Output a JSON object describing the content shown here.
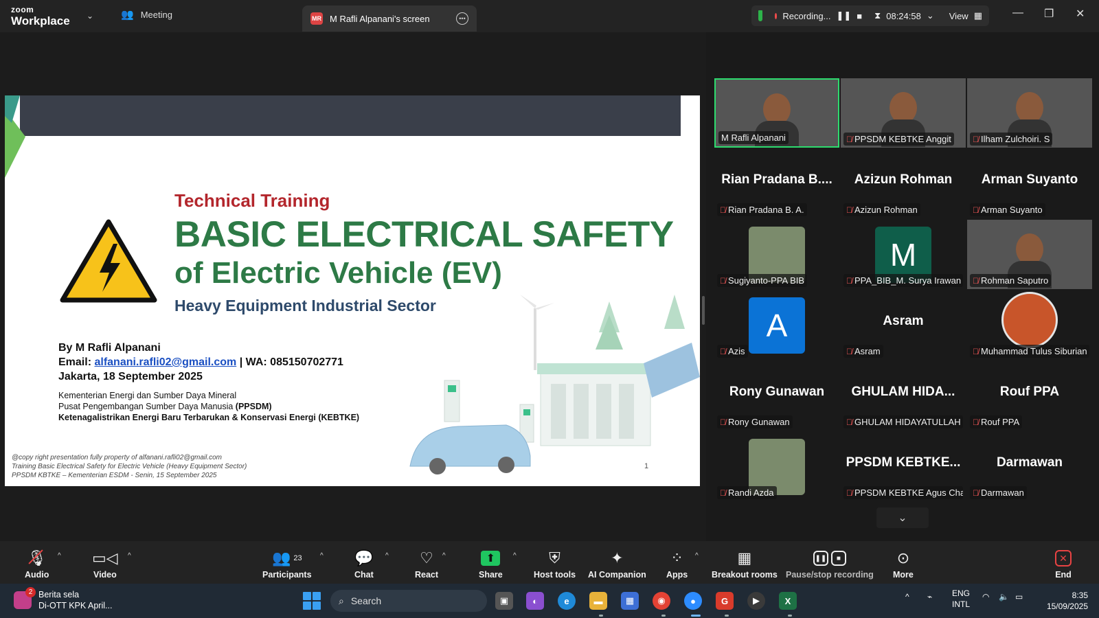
{
  "app": {
    "brand_top": "zoom",
    "brand_bottom": "Workplace"
  },
  "tabs": {
    "meeting": "Meeting",
    "screen": "M Rafli Alpanani's screen",
    "screen_badge": "MR"
  },
  "status": {
    "recording": "Recording...",
    "timer": "08:24:58",
    "view": "View"
  },
  "slide": {
    "label": "Technical Training",
    "title_line1": "BASIC ELECTRICAL SAFETY",
    "title_line2": "of Electric Vehicle (EV)",
    "subtitle": "Heavy Equipment Industrial Sector",
    "author": "By M Rafli Alpanani",
    "email_label": "Email:",
    "email": "alfanani.rafli02@gmail.com",
    "wa": "| WA: 085150702771",
    "date": "Jakarta, 18 September 2025",
    "org1": "Kementerian Energi dan Sumber Daya Mineral",
    "org2_prefix": "Pusat Pengembangan Sumber Daya Manusia ",
    "org2_bold": "(PPSDM)",
    "org3": "Ketenagalistrikan Energi Baru Terbarukan & Konservasi Energi (KEBTKE)",
    "copy1": "@copy right presentation fully property of alfanani.rafli02@gmail.com",
    "copy2": "Training Basic Electrical Safety for Electric Vehicle (Heavy Equipment Sector)",
    "copy3": "PPSDM KBTKE – Kementerian ESDM - Senin, 15 September 2025",
    "page": "1"
  },
  "gallery": [
    {
      "name": "M Rafli Alpanani",
      "kind": "video",
      "active": true,
      "muted": false
    },
    {
      "name": "PPSDM KEBTKE Anggit",
      "kind": "video",
      "muted": true
    },
    {
      "name": "Ilham Zulchoiri. S",
      "kind": "video",
      "muted": true
    },
    {
      "name": "Rian Pradana B. A.",
      "big": "Rian Pradana B....",
      "kind": "name",
      "muted": true
    },
    {
      "name": "Azizun Rohman",
      "big": "Azizun Rohman",
      "kind": "name",
      "muted": true
    },
    {
      "name": "Arman Suyanto",
      "big": "Arman Suyanto",
      "kind": "name",
      "muted": true
    },
    {
      "name": "Sugiyanto-PPA BIB",
      "kind": "photo",
      "muted": true
    },
    {
      "name": "PPA_BIB_M. Surya Irawan",
      "kind": "letter",
      "letter": "M",
      "color": "#0f5e4a",
      "muted": true
    },
    {
      "name": "Rohman Saputro",
      "kind": "video",
      "muted": true
    },
    {
      "name": "Azis",
      "kind": "letter",
      "letter": "A",
      "color": "#0b73d6",
      "muted": true
    },
    {
      "name": "Asram",
      "big": "Asram",
      "kind": "name",
      "muted": true
    },
    {
      "name": "Muhammad Tulus Siburian",
      "kind": "circle",
      "muted": true
    },
    {
      "name": "Rony Gunawan",
      "big": "Rony Gunawan",
      "kind": "name",
      "muted": true
    },
    {
      "name": "GHULAM HIDAYATULLAH",
      "big": "GHULAM HIDA...",
      "kind": "name",
      "muted": true
    },
    {
      "name": "Rouf PPA",
      "big": "Rouf PPA",
      "kind": "name",
      "muted": true
    },
    {
      "name": "Randi Azda",
      "kind": "photo",
      "muted": true
    },
    {
      "name": "PPSDM KEBTKE Agus Cha...",
      "big": "PPSDM KEBTKE...",
      "kind": "name",
      "muted": true
    },
    {
      "name": "Darmawan",
      "big": "Darmawan",
      "kind": "name",
      "muted": true
    }
  ],
  "toolbar": {
    "audio": "Audio",
    "video": "Video",
    "participants": "Participants",
    "participants_count": "23",
    "chat": "Chat",
    "react": "React",
    "share": "Share",
    "host_tools": "Host tools",
    "ai_companion": "AI Companion",
    "apps": "Apps",
    "breakout": "Breakout rooms",
    "pause_recording": "Pause/stop recording",
    "more": "More",
    "end": "End"
  },
  "taskbar": {
    "news_title": "Berita sela",
    "news_sub": "Di-OTT KPK April...",
    "news_badge": "2",
    "search": "Search",
    "lang1": "ENG",
    "lang2": "INTL",
    "time": "8:35",
    "date": "15/09/2025"
  },
  "colors": {
    "accent_green": "#2ddc6e",
    "rec_red": "#f04b4b",
    "title_green": "#2d7a46",
    "label_red": "#b3262c"
  }
}
